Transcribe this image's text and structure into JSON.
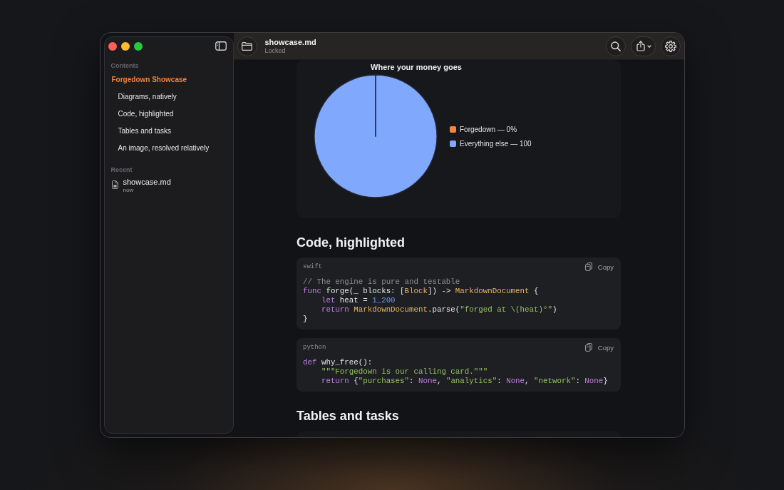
{
  "window": {
    "title": "showcase.md",
    "status": "Locked"
  },
  "sidebar": {
    "contents_label": "Contents",
    "outline": [
      {
        "label": "Forgedown Showcase",
        "selected": true,
        "children": [
          {
            "label": "Diagrams, natively",
            "selected": false
          },
          {
            "label": "Code, highlighted",
            "selected": false
          },
          {
            "label": "Tables and tasks",
            "selected": false
          },
          {
            "label": "An image, resolved relatively",
            "selected": false
          }
        ]
      }
    ],
    "recent_label": "Recent",
    "recent": [
      {
        "name": "showcase.md",
        "time": "now"
      }
    ]
  },
  "document": {
    "blocks": [
      {
        "kind": "chart",
        "chart_data": {
          "type": "pie",
          "title": "Where your money goes",
          "categories": [
            "Forgedown",
            "Everything else"
          ],
          "values": [
            0,
            100
          ]
        },
        "legend": [
          {
            "value_label": "— 0%",
            "color": "#f5863a"
          },
          {
            "value_label": "— 100",
            "color": "#80a8fc"
          }
        ]
      },
      {
        "kind": "heading",
        "text": "Code, highlighted"
      },
      {
        "kind": "code",
        "language": "swift",
        "copy_label": "Copy",
        "lines": [
          [
            {
              "kind": "comment",
              "text": "// The engine is pure and testable"
            }
          ],
          [
            {
              "kind": "keyword",
              "text": "func"
            },
            {
              "kind": "plain",
              "text": " forge(_ blocks: ["
            },
            {
              "kind": "type",
              "text": "Block"
            },
            {
              "kind": "plain",
              "text": "]) -> "
            },
            {
              "kind": "type",
              "text": "MarkdownDocument"
            },
            {
              "kind": "plain",
              "text": " {"
            }
          ],
          [
            {
              "kind": "keyword",
              "text": "    let"
            },
            {
              "kind": "plain",
              "text": " heat = "
            },
            {
              "kind": "number",
              "text": "1_200"
            }
          ],
          [
            {
              "kind": "keyword",
              "text": "    return"
            },
            {
              "kind": "type",
              "text": " MarkdownDocument"
            },
            {
              "kind": "plain",
              "text": ".parse("
            },
            {
              "kind": "string",
              "text": "\"forged at \\(heat)°\""
            },
            {
              "kind": "plain",
              "text": ")"
            }
          ],
          [
            {
              "kind": "plain",
              "text": "}"
            }
          ]
        ]
      },
      {
        "kind": "code",
        "language": "python",
        "copy_label": "Copy",
        "lines": [
          [
            {
              "kind": "keyword",
              "text": "def"
            },
            {
              "kind": "plain",
              "text": " why_free():"
            }
          ],
          [
            {
              "kind": "string",
              "text": "    \"\"\"Forgedown is our calling card.\"\"\""
            }
          ],
          [
            {
              "kind": "keyword",
              "text": "    return"
            },
            {
              "kind": "plain",
              "text": " {"
            },
            {
              "kind": "string",
              "text": "\"purchases\""
            },
            {
              "kind": "plain",
              "text": ": "
            },
            {
              "kind": "keyword",
              "text": "None"
            },
            {
              "kind": "plain",
              "text": ", "
            },
            {
              "kind": "string",
              "text": "\"analytics\""
            },
            {
              "kind": "plain",
              "text": ": "
            },
            {
              "kind": "keyword",
              "text": "None"
            },
            {
              "kind": "plain",
              "text": ", "
            },
            {
              "kind": "string",
              "text": "\"network\""
            },
            {
              "kind": "plain",
              "text": ": "
            },
            {
              "kind": "keyword",
              "text": "None"
            },
            {
              "kind": "plain",
              "text": "}"
            }
          ]
        ]
      },
      {
        "kind": "heading",
        "text": "Tables and tasks"
      },
      {
        "kind": "card"
      }
    ]
  }
}
